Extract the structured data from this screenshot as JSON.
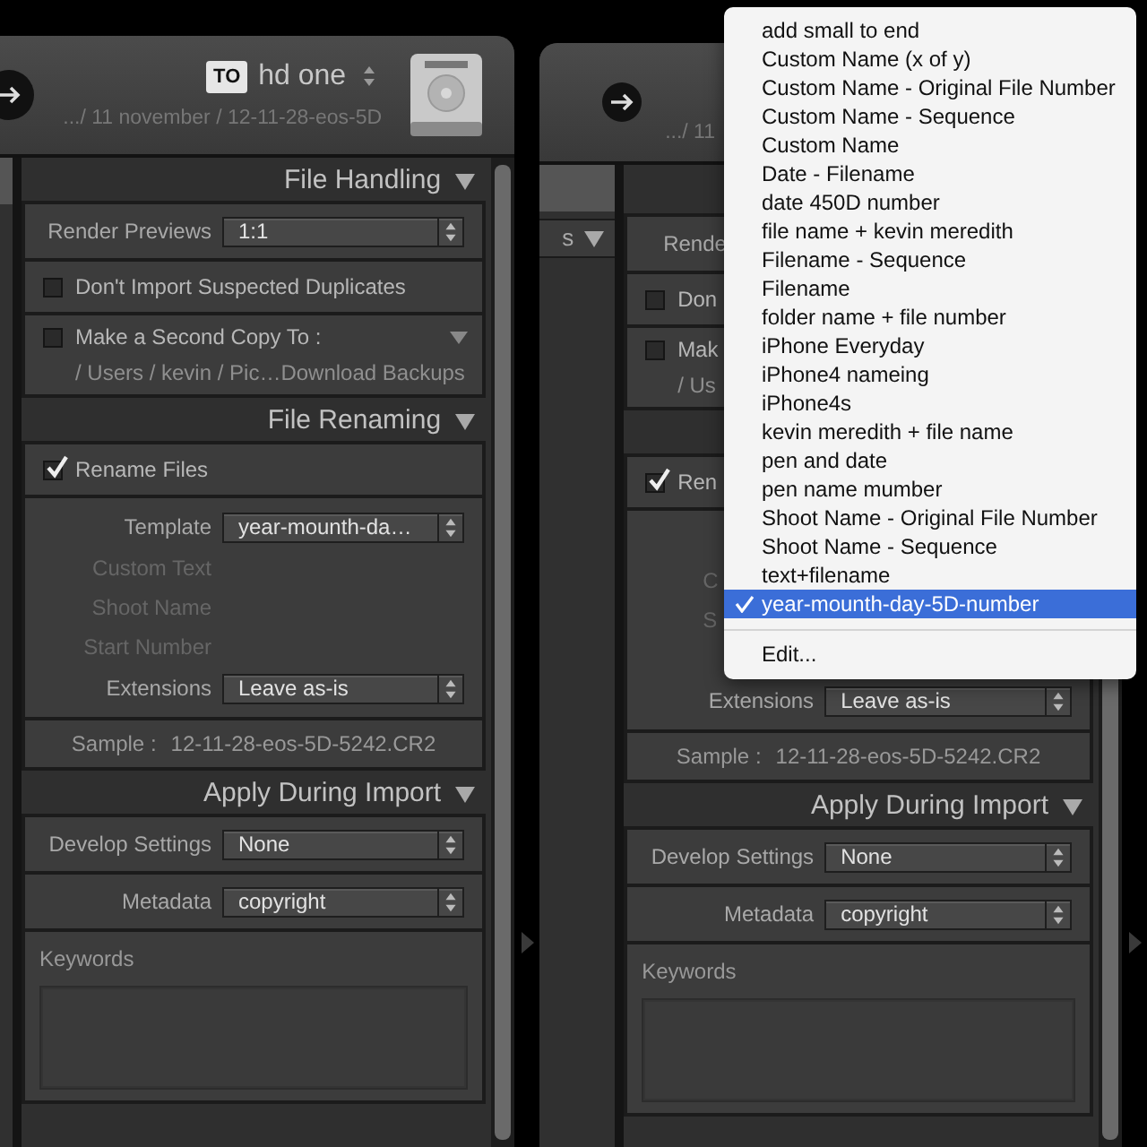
{
  "left_window": {
    "destination_badge": "TO",
    "volume": "hd one",
    "path": ".../ 11 november / 12-11-28-eos-5D",
    "sections": [
      {
        "title": "File Handling",
        "boxes": [
          [
            {
              "kind": "select",
              "label": "Render Previews",
              "value": "1:1"
            }
          ],
          [
            {
              "kind": "checkbox",
              "label": "Don't Import Suspected Duplicates",
              "checked": false
            }
          ],
          [
            {
              "kind": "checkbox",
              "label": "Make a Second Copy To :",
              "checked": false,
              "menu": true,
              "detail": "/ Users / kevin / Pic…Download Backups"
            }
          ]
        ]
      },
      {
        "title": "File Renaming",
        "boxes": [
          [
            {
              "kind": "checkbox",
              "label": "Rename Files",
              "checked": true
            }
          ],
          [
            {
              "kind": "select",
              "label": "Template",
              "value": "year-mounth-da…"
            },
            {
              "kind": "dim",
              "label": "Custom Text"
            },
            {
              "kind": "dim",
              "label": "Shoot Name"
            },
            {
              "kind": "dim",
              "label": "Start Number"
            },
            {
              "kind": "select",
              "label": "Extensions",
              "value": "Leave as-is"
            }
          ],
          [
            {
              "kind": "sample",
              "label": "Sample :",
              "value": "12-11-28-eos-5D-5242.CR2"
            }
          ]
        ]
      },
      {
        "title": "Apply During Import",
        "boxes": [
          [
            {
              "kind": "select",
              "label": "Develop Settings",
              "value": "None"
            }
          ],
          [
            {
              "kind": "select",
              "label": "Metadata",
              "value": "copyright"
            }
          ],
          [
            {
              "kind": "keywords",
              "label": "Keywords"
            }
          ]
        ]
      }
    ]
  },
  "right_window": {
    "path": ".../ 11",
    "side_header": "s",
    "sections": [
      {
        "boxes": [
          [
            {
              "kind": "select",
              "label": "Rende",
              "clipped": true
            }
          ],
          [
            {
              "kind": "checkbox",
              "label": "Don",
              "checked": false
            }
          ],
          [
            {
              "kind": "checkbox",
              "label": "Mak",
              "checked": false,
              "detail": "/ Us"
            }
          ]
        ]
      },
      {
        "boxes": [
          [
            {
              "kind": "checkbox",
              "label": "Ren",
              "checked": true
            }
          ],
          [
            {
              "kind": "select"
            },
            {
              "kind": "dim",
              "label": "C",
              "clipped": true
            },
            {
              "kind": "dim",
              "label": "S",
              "clipped": true
            },
            {
              "kind": "dim"
            },
            {
              "kind": "select",
              "label": "Extensions",
              "value": "Leave as-is"
            }
          ],
          [
            {
              "kind": "sample",
              "label": "Sample :",
              "value": "12-11-28-eos-5D-5242.CR2"
            }
          ]
        ]
      },
      {
        "title": "Apply During Import",
        "boxes": [
          [
            {
              "kind": "select",
              "label": "Develop Settings",
              "value": "None"
            }
          ],
          [
            {
              "kind": "select",
              "label": "Metadata",
              "value": "copyright"
            }
          ],
          [
            {
              "kind": "keywords",
              "label": "Keywords"
            }
          ]
        ]
      }
    ]
  },
  "template_menu": {
    "items": [
      {
        "label": "add small to end",
        "selected": false
      },
      {
        "label": "Custom Name (x of y)",
        "selected": false
      },
      {
        "label": "Custom Name - Original File Number",
        "selected": false
      },
      {
        "label": "Custom Name - Sequence",
        "selected": false
      },
      {
        "label": "Custom Name",
        "selected": false
      },
      {
        "label": "Date - Filename",
        "selected": false
      },
      {
        "label": "date 450D number",
        "selected": false
      },
      {
        "label": "file name + kevin meredith",
        "selected": false
      },
      {
        "label": "Filename - Sequence",
        "selected": false
      },
      {
        "label": "Filename",
        "selected": false
      },
      {
        "label": "folder name + file number",
        "selected": false
      },
      {
        "label": "iPhone Everyday",
        "selected": false
      },
      {
        "label": "iPhone4 nameing",
        "selected": false
      },
      {
        "label": "iPhone4s",
        "selected": false
      },
      {
        "label": "kevin meredith + file name",
        "selected": false
      },
      {
        "label": "pen and date",
        "selected": false
      },
      {
        "label": "pen name mumber",
        "selected": false
      },
      {
        "label": "Shoot Name - Original File Number",
        "selected": false
      },
      {
        "label": "Shoot Name - Sequence",
        "selected": false
      },
      {
        "label": "text+filename",
        "selected": false
      },
      {
        "label": "year-mounth-day-5D-number",
        "selected": true
      }
    ],
    "footer": "Edit..."
  }
}
